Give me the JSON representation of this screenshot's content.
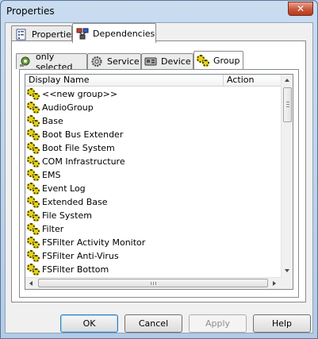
{
  "window": {
    "title": "Properties",
    "close_glyph": "✕"
  },
  "outer_tabs": [
    {
      "label": "Properties",
      "icon": "properties-sheet-icon",
      "active": false
    },
    {
      "label": "Dependencies",
      "icon": "dependencies-icon",
      "active": true
    }
  ],
  "inner_tabs": [
    {
      "label": "only selected",
      "icon": "selected-tree-icon",
      "active": false
    },
    {
      "label": "Service",
      "icon": "service-gear-icon",
      "active": false
    },
    {
      "label": "Device",
      "icon": "device-card-icon",
      "active": false
    },
    {
      "label": "Group",
      "icon": "group-gears-icon",
      "active": true
    }
  ],
  "list": {
    "columns": [
      "Display Name",
      "Action"
    ],
    "rows": [
      "<<new group>>",
      "AudioGroup",
      "Base",
      "Boot Bus Extender",
      "Boot File System",
      "COM Infrastructure",
      "EMS",
      "Event Log",
      "Extended Base",
      "File System",
      "Filter",
      "FSFilter Activity Monitor",
      "FSFilter Anti-Virus",
      "FSFilter Bottom"
    ],
    "row_icon": "group-gears-icon"
  },
  "buttons": {
    "ok": "OK",
    "cancel": "Cancel",
    "apply": "Apply",
    "help": "Help"
  },
  "colors": {
    "gear_fill": "#e8d21a",
    "close_red": "#c9553a",
    "frame": "#bcd3ea"
  }
}
